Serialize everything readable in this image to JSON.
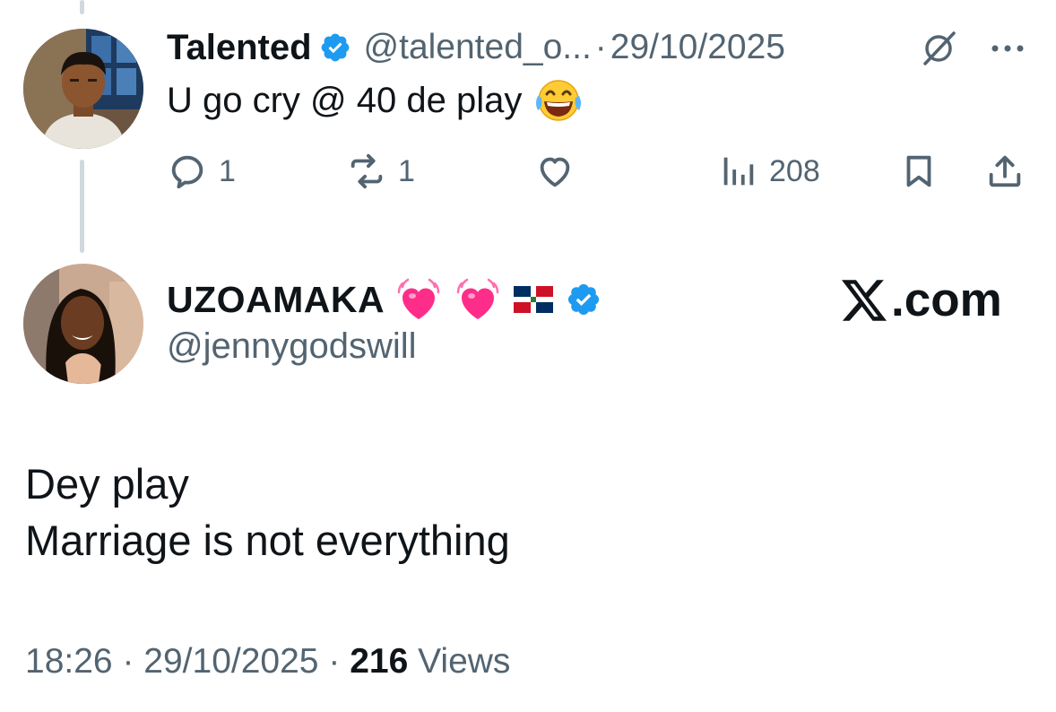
{
  "parent_tweet": {
    "author_name": "Talented",
    "handle": "@talented_o...",
    "separator": "·",
    "date": "29/10/2025",
    "text": "U go cry @ 40 de play",
    "emoji": "face-with-tears-of-joy",
    "replies": "1",
    "reposts": "1",
    "views": "208"
  },
  "reply_tweet": {
    "author_name": "UZOAMAKA",
    "handle": "@jennygodswill",
    "watermark": ".com",
    "lines": [
      "Dey play",
      "Marriage is not everything"
    ],
    "time": "18:26",
    "sep1": "·",
    "date": "29/10/2025",
    "sep2": "·",
    "views_count": "216",
    "views_label": "Views"
  },
  "colors": {
    "verified": "#1d9bf0",
    "muted": "#536471",
    "text": "#0f1419",
    "thread_line": "#cfd9de",
    "heart": "#ff2d8a"
  },
  "icons": [
    "verified-badge-icon",
    "grok-icon",
    "more-icon",
    "reply-icon",
    "repost-icon",
    "like-icon",
    "views-icon",
    "bookmark-icon",
    "share-icon",
    "growing-heart-icon",
    "dominican-flag-icon",
    "x-logo-icon"
  ]
}
